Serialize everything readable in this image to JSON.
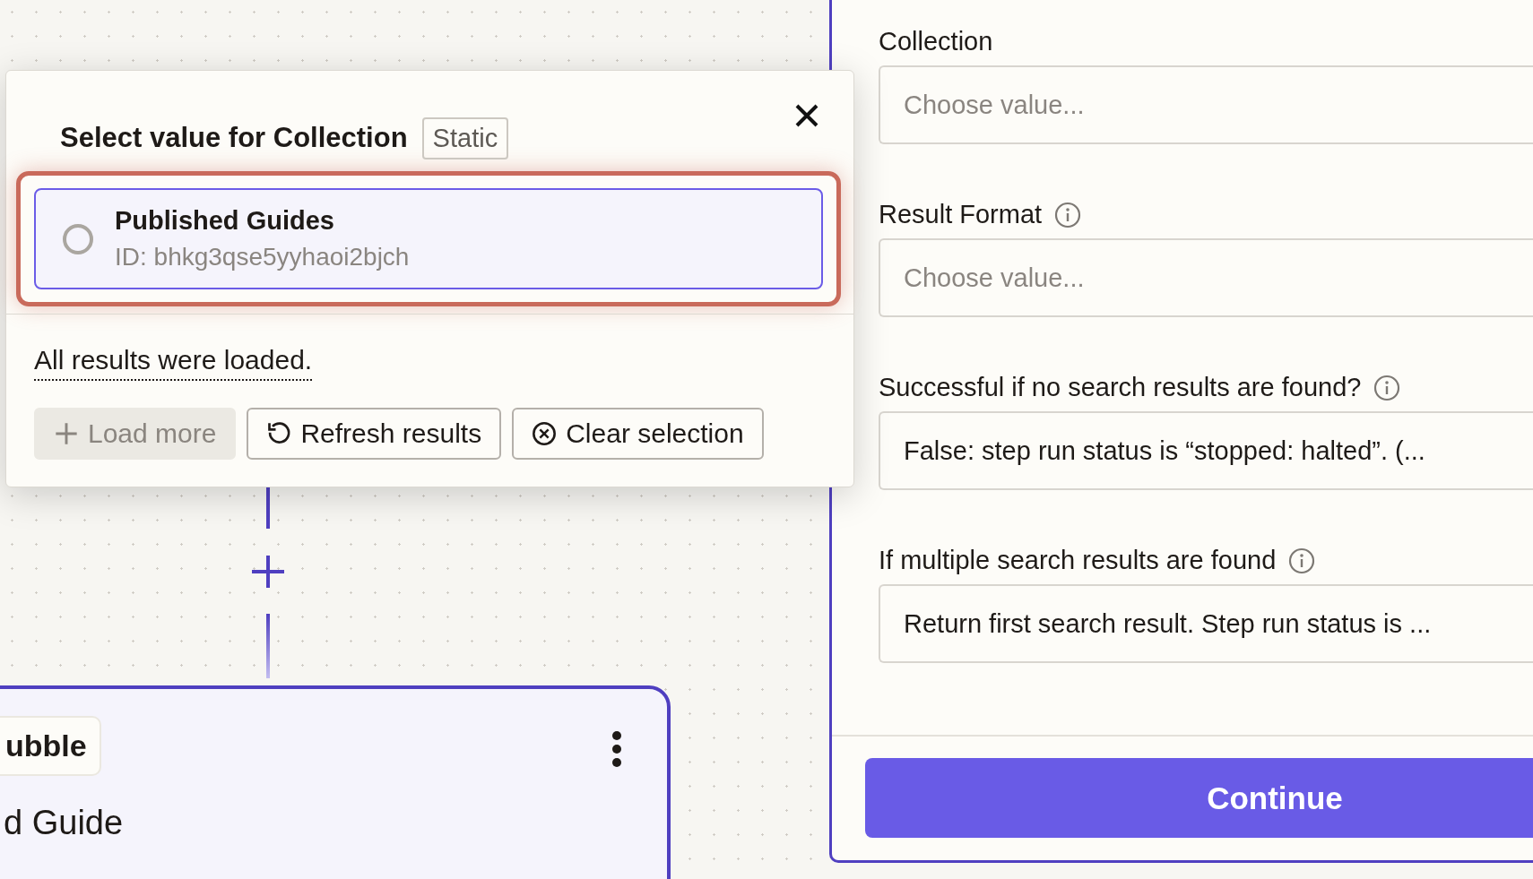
{
  "canvas": {
    "node": {
      "app_badge": "ubble",
      "title": "d Guide"
    }
  },
  "popup": {
    "title": "Select value for Collection",
    "mode_badge": "Static",
    "options": [
      {
        "name": "Published Guides",
        "id": "ID: bhkg3qse5yyhaoi2bjch",
        "selected": false,
        "highlighted": true
      }
    ],
    "status": "All results were loaded.",
    "buttons": [
      {
        "label": "Load more",
        "kind": "add",
        "disabled": true
      },
      {
        "label": "Refresh results",
        "kind": "refresh",
        "disabled": false
      },
      {
        "label": "Clear selection",
        "kind": "clear",
        "disabled": false
      }
    ]
  },
  "panel": {
    "fields": [
      {
        "label": "Collection",
        "info": false,
        "placeholder": "Choose value..."
      },
      {
        "label": "Result Format",
        "info": true,
        "placeholder": "Choose value..."
      },
      {
        "label": "Successful if no search results are found?",
        "info": true,
        "value": "False: step run status is “stopped: halted”. (..."
      },
      {
        "label": "If multiple search results are found",
        "info": true,
        "value": "Return first search result. Step run status is ..."
      }
    ],
    "continue_button": "Continue"
  }
}
